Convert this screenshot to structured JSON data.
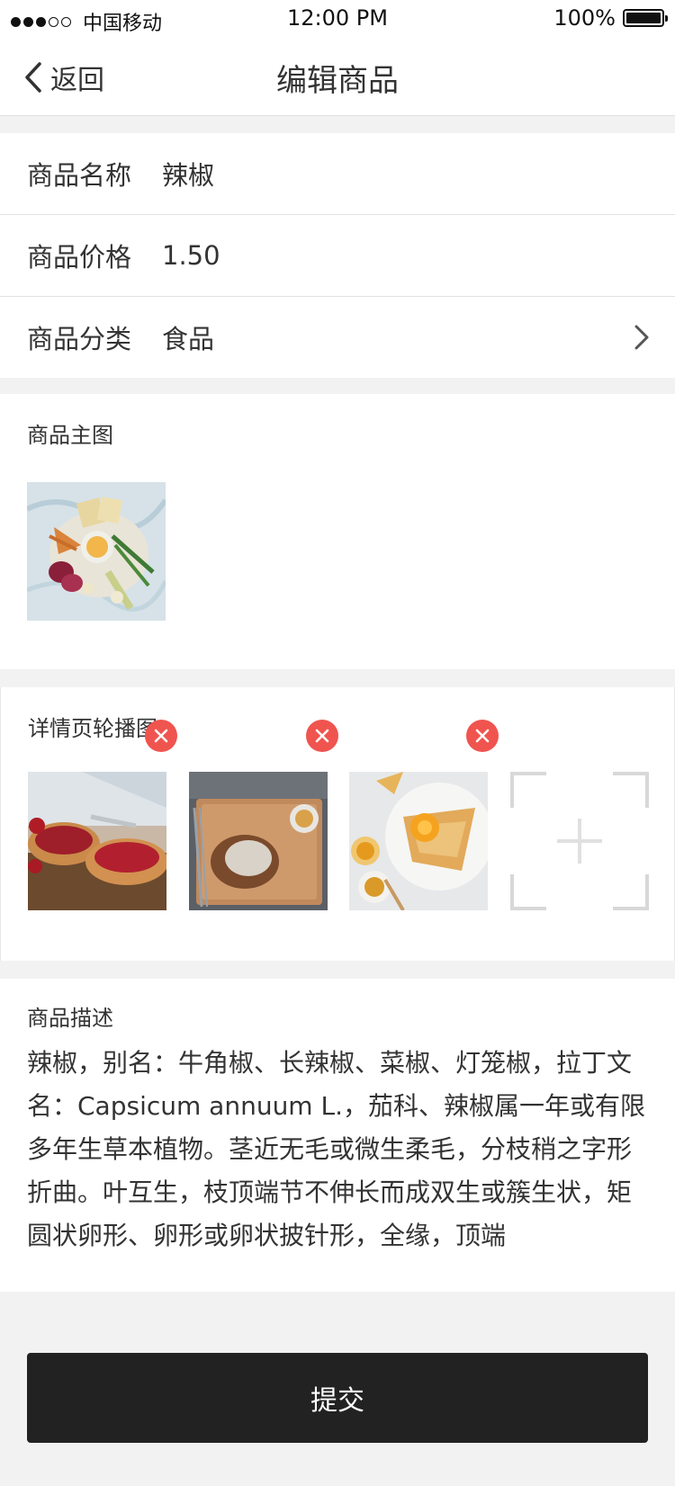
{
  "status_bar": {
    "carrier": "中国移动",
    "time": "12:00 PM",
    "battery": "100%"
  },
  "nav": {
    "back_label": "返回",
    "title": "编辑商品"
  },
  "form": {
    "name_label": "商品名称",
    "name_value": "辣椒",
    "price_label": "商品价格",
    "price_value": "1.50",
    "category_label": "商品分类",
    "category_value": "食品"
  },
  "main_image": {
    "title": "商品主图"
  },
  "carousel": {
    "title": "详情页轮播图"
  },
  "description": {
    "title": "商品描述",
    "text": "辣椒，别名：牛角椒、长辣椒、菜椒、灯笼椒，拉丁文名：Capsicum annuum L.，茄科、辣椒属一年或有限多年生草本植物。茎近无毛或微生柔毛，分枝稍之字形折曲。叶互生，枝顶端节不伸长而成双生或簇生状，矩圆状卵形、卵形或卵状披针形，全缘，顶端"
  },
  "submit_label": "提交",
  "colors": {
    "accent_remove": "#f0544f",
    "submit_bg": "#222222",
    "page_bg": "#f2f2f2"
  }
}
